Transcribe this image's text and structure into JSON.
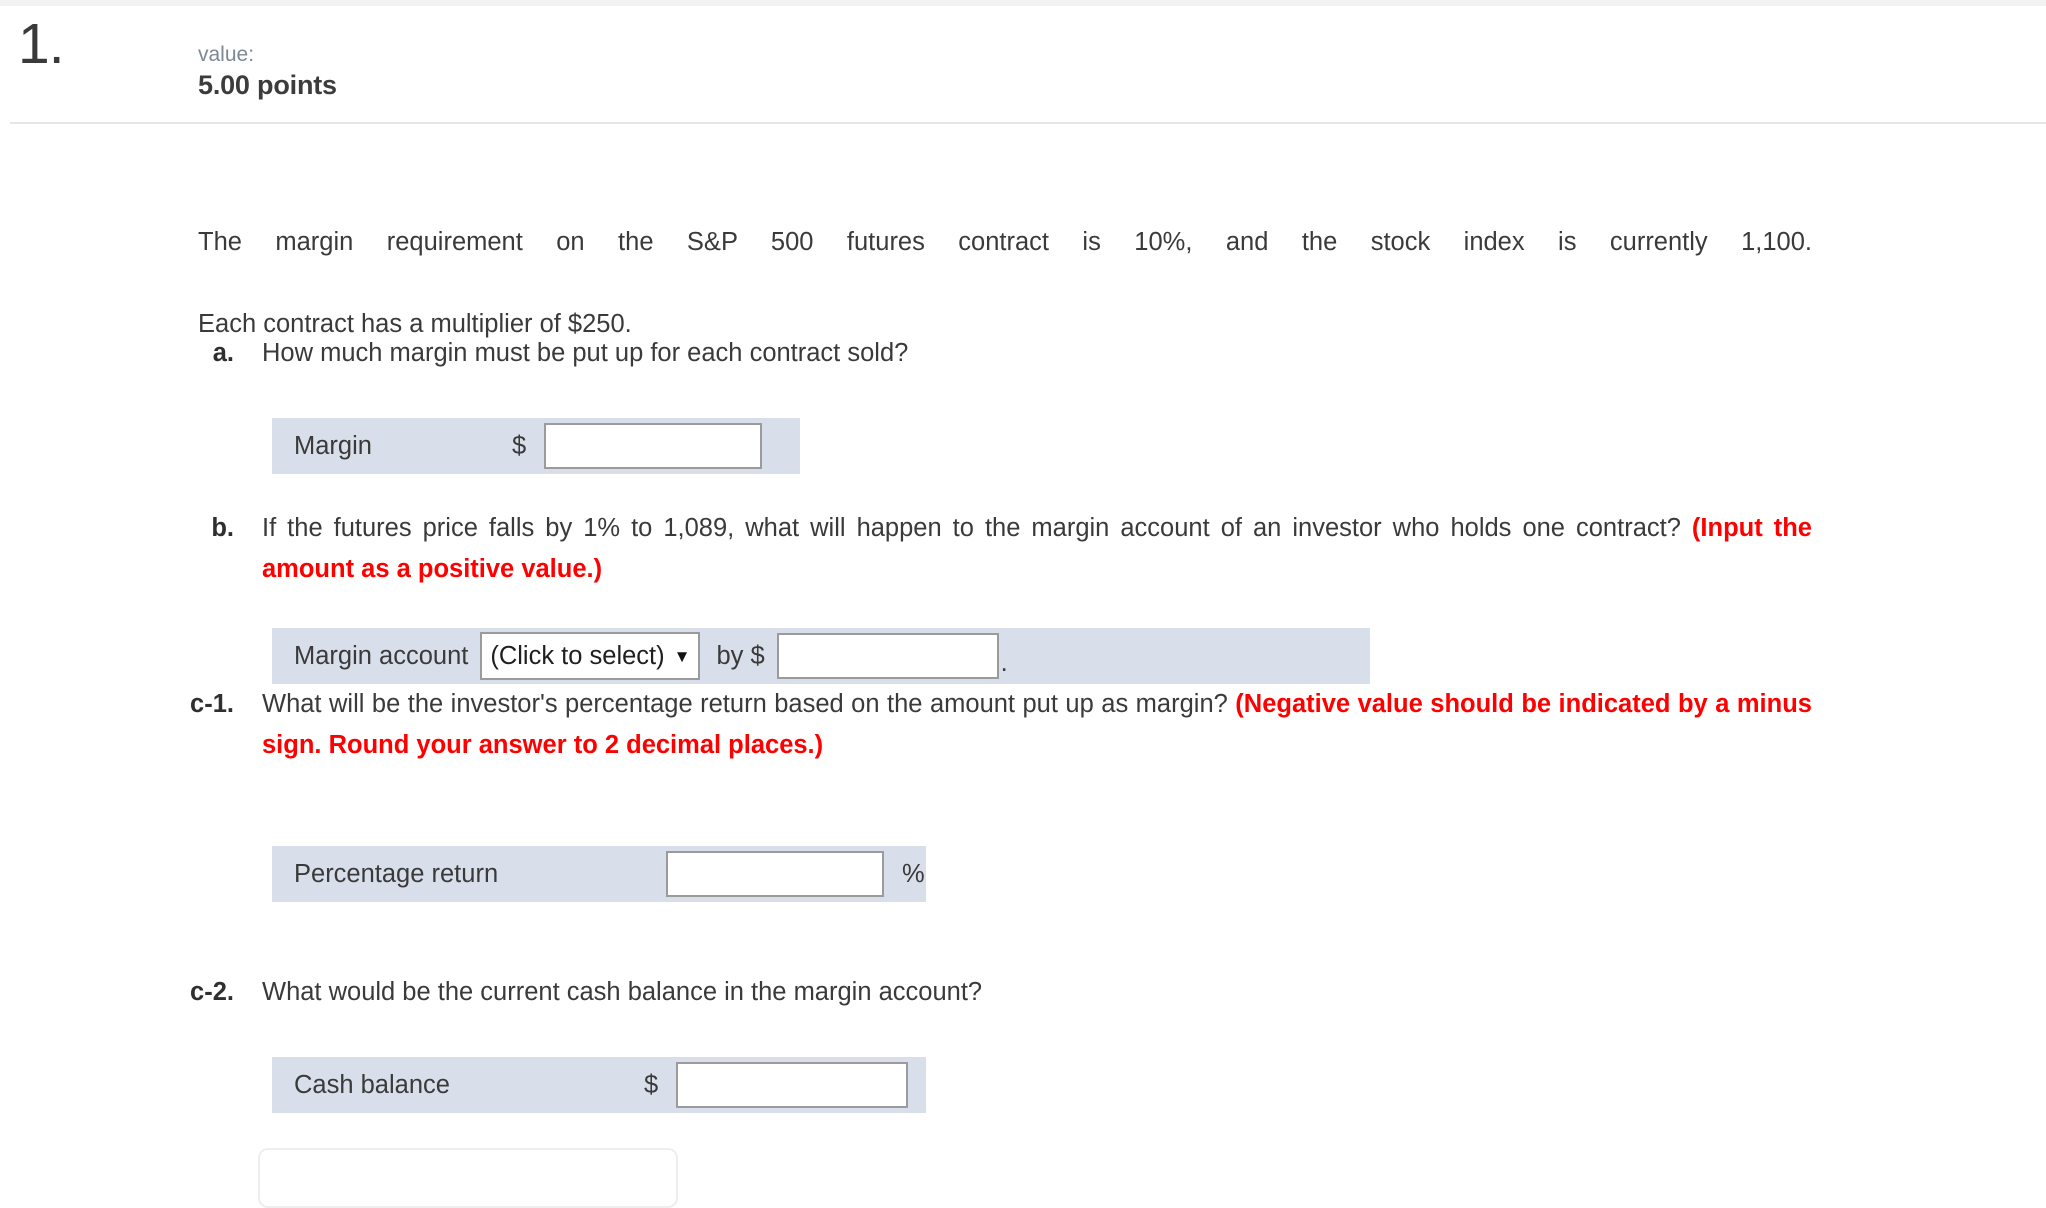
{
  "header": {
    "question_number": "1.",
    "value_label": "value:",
    "points": "5.00 points"
  },
  "question": {
    "stem_line1": "The margin requirement on the S&P 500 futures contract is 10%, and the stock index is currently 1,100.",
    "stem_line2": "Each contract has a multiplier of $250.",
    "parts": [
      {
        "label": "a.",
        "text": "How much margin must be put up for each contract sold?",
        "red_text": "",
        "answer": {
          "label": "Margin",
          "prefix_symbol": "$",
          "value": "",
          "suffix_symbol": ""
        }
      },
      {
        "label": "b.",
        "text_line1": "If the futures price falls by 1% to 1,089, what will happen to the margin account of an investor who",
        "text_line2": "holds one contract?",
        "red_text": "(Input the amount as a positive value.)",
        "answer": {
          "label": "Margin account",
          "select_value": "(Click to select)",
          "select_caret": "▼",
          "mid_text": "by $",
          "value": "",
          "suffix_symbol": "."
        }
      },
      {
        "label": "c-1.",
        "text": "What will be the investor's percentage return based on the amount put up as margin?",
        "red_text_line1": "(Negative value",
        "red_text_line2": "should be indicated by a minus sign. Round your answer to 2 decimal places.)",
        "answer": {
          "label": "Percentage return",
          "prefix_symbol": "",
          "value": "",
          "suffix_symbol": "%"
        }
      },
      {
        "label": "c-2.",
        "text": "What would be the current cash balance in the margin account?",
        "red_text": "",
        "answer": {
          "label": "Cash balance",
          "prefix_symbol": "$",
          "value": "",
          "suffix_symbol": ""
        }
      }
    ]
  },
  "colors": {
    "answer_box_bg": "#d9dfea",
    "instruction_red": "#ff0000",
    "input_border": "#9b9b9b",
    "value_label": "#7d8895"
  }
}
